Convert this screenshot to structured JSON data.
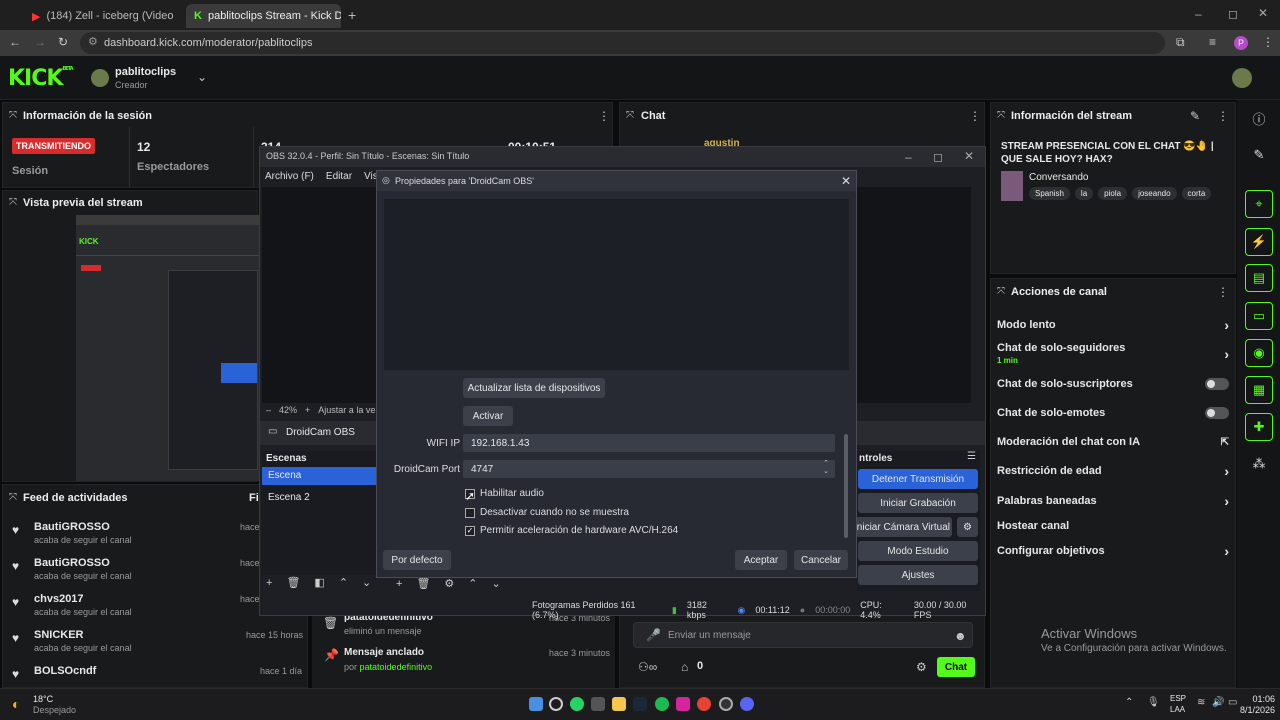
{
  "browser": {
    "tabs": [
      {
        "label": "(184) Zell - iceberg (Video o"
      },
      {
        "label": "pablitoclips Stream - Kick Dash"
      }
    ],
    "url": "dashboard.kick.com/moderator/pablitoclips",
    "profile_initial": "P"
  },
  "kick": {
    "brand": "KICK",
    "brand_sup": "BETA",
    "channel_name": "pablitoclips",
    "channel_role": "Creador",
    "accent": "#53fc18"
  },
  "session": {
    "title": "Información de la sesión",
    "status": "TRANSMITIENDO",
    "status_label": "Sesión",
    "viewers": "12",
    "viewers_label": "Espectadores",
    "followers_partial": "314",
    "timer_partial": "00:10:51"
  },
  "preview": {
    "title": "Vista previa del stream"
  },
  "feed": {
    "title": "Feed de actividades",
    "filter_partial": "Fil",
    "items": [
      {
        "name": "BautiGROSSO",
        "action": "acaba de seguir el canal",
        "time": "hace"
      },
      {
        "name": "BautiGROSSO",
        "action": "acaba de seguir el canal",
        "time": "hace"
      },
      {
        "name": "chvs2017",
        "action": "acaba de seguir el canal",
        "time": "hace"
      },
      {
        "name": "SNICKER",
        "action": "acaba de seguir el canal",
        "time": "hace 15 horas"
      },
      {
        "name": "BOLSOcndf",
        "action": "acaba de seguir el canal",
        "time": "hace 1 día"
      }
    ]
  },
  "chat": {
    "title": "Chat",
    "first_user_partial": "agustin",
    "mod_items": [
      {
        "name": "patatoidedefinitivo",
        "action": "eliminó un mensaje",
        "time": "hace 3 minutos"
      },
      {
        "name": "Mensaje anclado",
        "by_label": "por",
        "by_user": "patatoidedefinitivo",
        "time": "hace 3 minutos"
      }
    ],
    "placeholder": "Enviar un mensaje",
    "count_a": "0",
    "send_label": "Chat"
  },
  "stream_info": {
    "title": "Información del stream",
    "stream_title": "STREAM PRESENCIAL CON EL CHAT 😎🤚 | QUE SALE HOY? HAX?",
    "category": "Conversando",
    "tags": [
      "Spanish",
      "la",
      "piola",
      "joseando",
      "corta"
    ]
  },
  "channel_actions": {
    "title": "Acciones de canal",
    "items": [
      {
        "label": "Modo lento",
        "sub": "",
        "control": "chevron"
      },
      {
        "label": "Chat de solo-seguidores",
        "sub": "1 min",
        "control": "chevron"
      },
      {
        "label": "Chat de solo-suscriptores",
        "sub": "",
        "control": "toggle"
      },
      {
        "label": "Chat de solo-emotes",
        "sub": "",
        "control": "toggle"
      },
      {
        "label": "Moderación del chat con IA",
        "sub": "",
        "control": "external"
      },
      {
        "label": "Restricción de edad",
        "sub": "",
        "control": "chevron"
      },
      {
        "label": "Palabras baneadas",
        "sub": "",
        "control": "chevron"
      },
      {
        "label": "Hostear canal",
        "sub": "",
        "control": "none"
      },
      {
        "label": "Configurar objetivos",
        "sub": "",
        "control": "chevron"
      }
    ]
  },
  "obs": {
    "title": "OBS 32.0.4 - Perfil: Sin Título - Escenas: Sin Título",
    "menus": [
      "Archivo (F)",
      "Editar",
      "Vista"
    ],
    "zoom": "42%",
    "fit_label": "Ajustar a la ve",
    "source_name": "DroidCam OBS",
    "scenes_title": "Escenas",
    "scenes": [
      "Escena",
      "Escena 2"
    ],
    "controls_title": "ntroles",
    "controls": [
      "Detener Transmisión",
      "Iniciar Grabación",
      "Iniciar Cámara Virtual",
      "Modo Estudio",
      "Ajustes"
    ],
    "status": {
      "dropped": "Fotogramas Perdidos 161 (6.7%)",
      "kbps": "3182 kbps",
      "live_time": "00:11:12",
      "rec_time": "00:00:00",
      "cpu": "CPU: 4.4%",
      "fps": "30.00 / 30.00 FPS"
    }
  },
  "dialog": {
    "title": "Propiedades para 'DroidCam OBS'",
    "refresh_label": "Actualizar lista de dispositivos",
    "activate_label": "Activar",
    "wifi_label": "WIFI IP",
    "wifi_value": "192.168.1.43",
    "port_label": "DroidCam Port",
    "port_value": "4747",
    "checks": [
      {
        "label": "Habilitar audio",
        "checked": false
      },
      {
        "label": "Desactivar cuando no se muestra",
        "checked": false
      },
      {
        "label": "Permitir aceleración de hardware AVC/H.264",
        "checked": true
      }
    ],
    "defaults_label": "Por defecto",
    "ok_label": "Aceptar",
    "cancel_label": "Cancelar"
  },
  "watermark": {
    "title": "Activar Windows",
    "sub": "Ve a Configuración para activar Windows."
  },
  "taskbar": {
    "weather_temp": "18°C",
    "weather_desc": "Despejado",
    "lang": "ESP",
    "lang_sub": "LAA",
    "time": "01:06",
    "date": "8/1/2026"
  }
}
